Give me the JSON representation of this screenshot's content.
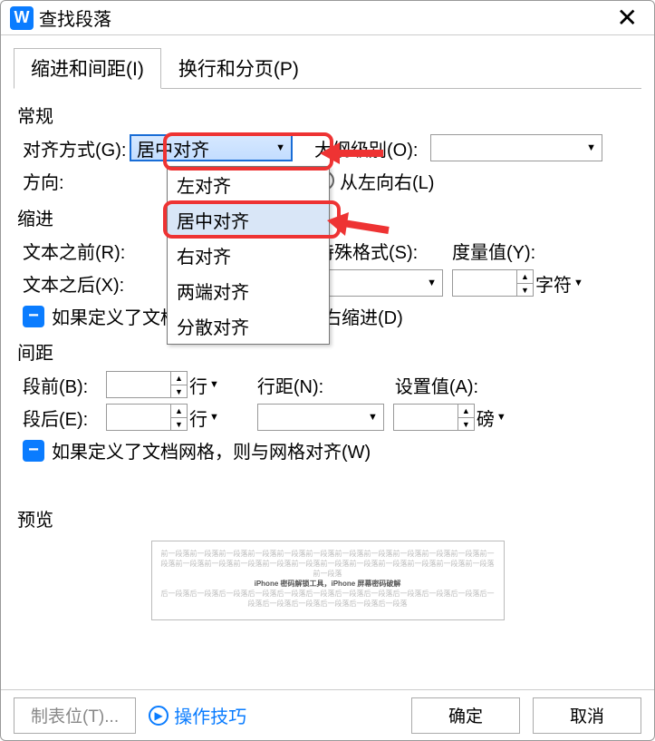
{
  "window": {
    "title": "查找段落"
  },
  "tabs": {
    "active": "缩进和间距(I)",
    "inactive": "换行和分页(P)"
  },
  "sections": {
    "general": "常规",
    "indent": "缩进",
    "spacing": "间距",
    "preview": "预览"
  },
  "general": {
    "align_label": "对齐方式(G):",
    "align_value": "居中对齐",
    "outline_label": "大纲级别(O):",
    "outline_value": "",
    "direction_label": "方向:",
    "dir_ltr": "从左向右(L)"
  },
  "align_options": [
    "左对齐",
    "居中对齐",
    "右对齐",
    "两端对齐",
    "分散对齐"
  ],
  "indent": {
    "before_label": "文本之前(R):",
    "after_label": "文本之后(X):",
    "special_label": "特殊格式(S):",
    "measure_label": "度量值(Y):",
    "unit": "字符",
    "check_label": "如果定义了文档网格，则自动调整右缩进(D)"
  },
  "spacing": {
    "before_label": "段前(B):",
    "after_label": "段后(E):",
    "line_unit": "行",
    "linespace_label": "行距(N):",
    "setvalue_label": "设置值(A):",
    "point_unit": "磅",
    "check_label": "如果定义了文档网格，则与网格对齐(W)"
  },
  "preview_text": {
    "light": "前一段落前一段落前一段落前一段落前一段落前一段落前一段落前一段落前一段落前一段落前一段落前一段落前一段落前一段落前一段落前一段落前一段落前一段落前一段落前一段落前一段落前一段落前一段落前一段落",
    "dark": "iPhone 密码解锁工具，iPhone 屏幕密码破解",
    "light2": "后一段落后一段落后一段落后一段落后一段落后一段落后一段落后一段落后一段落后一段落后一段落后一段落后一段落后一段落后一段落后一段落后一段落"
  },
  "footer": {
    "tabs": "制表位(T)...",
    "tips": "操作技巧",
    "ok": "确定",
    "cancel": "取消"
  },
  "check_minus": "−"
}
